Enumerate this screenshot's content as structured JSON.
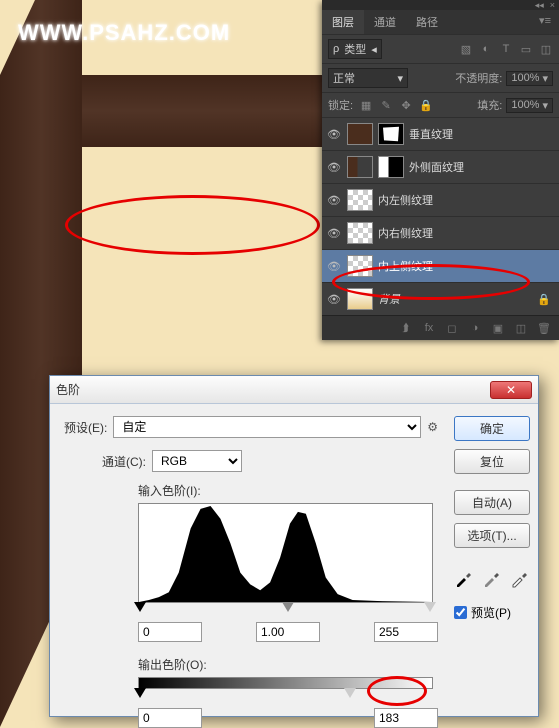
{
  "watermark": "WWW.PSAHZ.COM",
  "layers_panel": {
    "tabs": [
      "图层",
      "通道",
      "路径"
    ],
    "filter_label": "类型",
    "blend_mode": "正常",
    "opacity_label": "不透明度:",
    "opacity_value": "100%",
    "lock_label": "锁定:",
    "fill_label": "填充:",
    "fill_value": "100%",
    "layers": [
      {
        "name": "垂直纹理",
        "eye": true,
        "masked": true
      },
      {
        "name": "外侧面纹理",
        "eye": true,
        "masked": true
      },
      {
        "name": "内左侧纹理",
        "eye": true
      },
      {
        "name": "内右侧纹理",
        "eye": true
      },
      {
        "name": "内上侧纹理",
        "eye": true,
        "selected": true
      },
      {
        "name": "背景",
        "eye": true,
        "locked": true,
        "bg": true
      }
    ]
  },
  "levels_dialog": {
    "title": "色阶",
    "preset_label": "预设(E):",
    "preset_value": "自定",
    "channel_label": "通道(C):",
    "channel_value": "RGB",
    "input_levels_label": "输入色阶(I):",
    "input_black": "0",
    "input_mid": "1.00",
    "input_white": "255",
    "output_levels_label": "输出色阶(O):",
    "output_black": "0",
    "output_white": "183",
    "buttons": {
      "ok": "确定",
      "cancel": "复位",
      "auto": "自动(A)",
      "options": "选项(T)..."
    },
    "preview_label": "预览(P)"
  },
  "chart_data": {
    "type": "area",
    "title": "",
    "xlabel": "",
    "ylabel": "",
    "xlim": [
      0,
      255
    ],
    "categories": [
      0,
      16,
      32,
      48,
      64,
      80,
      96,
      112,
      128,
      144,
      160,
      176,
      192,
      208,
      224,
      240,
      255
    ],
    "values": [
      0,
      2,
      8,
      55,
      98,
      70,
      25,
      10,
      22,
      68,
      90,
      50,
      14,
      2,
      0,
      0,
      0
    ]
  }
}
